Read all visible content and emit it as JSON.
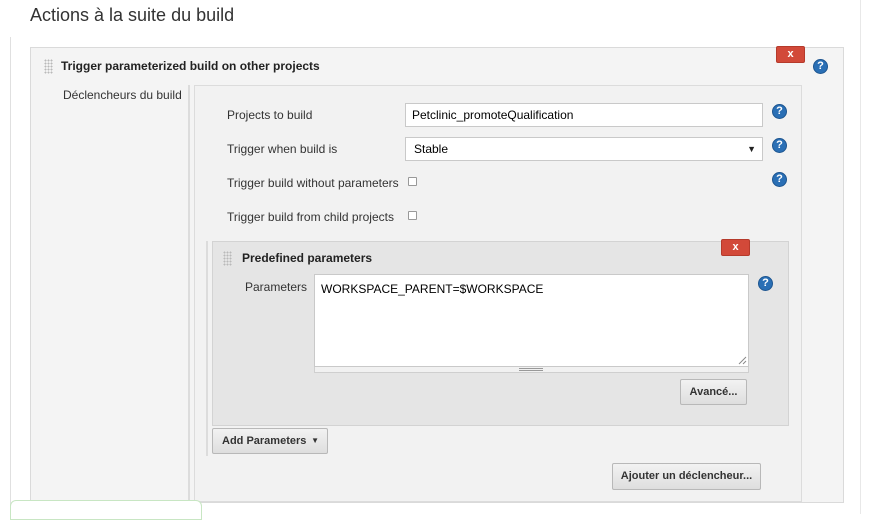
{
  "section": {
    "title": "Actions à la suite du build"
  },
  "outer": {
    "title": "Trigger parameterized build on other projects",
    "delete_label": "x",
    "help_label": "?",
    "left_label": "Déclencheurs du build"
  },
  "form": {
    "projects": {
      "label": "Projects to build",
      "value": "Petclinic_promoteQualification"
    },
    "trigger_when": {
      "label": "Trigger when build is",
      "selected": "Stable",
      "arrow": "▼"
    },
    "without_params": {
      "label": "Trigger build without parameters",
      "checked": false
    },
    "from_child": {
      "label": "Trigger build from child projects",
      "checked": false
    },
    "help_label": "?"
  },
  "predefined": {
    "title": "Predefined parameters",
    "delete_label": "x",
    "parameters_label": "Parameters",
    "parameters_value": "WORKSPACE_PARENT=$WORKSPACE",
    "help_label": "?",
    "advanced_button": "Avancé..."
  },
  "buttons": {
    "add_parameters": "Add Parameters",
    "add_parameters_caret": "▼",
    "add_trigger": "Ajouter un déclencheur..."
  },
  "colors": {
    "delete": "#d24939",
    "help": "#2a6fb5",
    "panel": "#f2f2f2",
    "subpanel": "#e5e5e5"
  }
}
